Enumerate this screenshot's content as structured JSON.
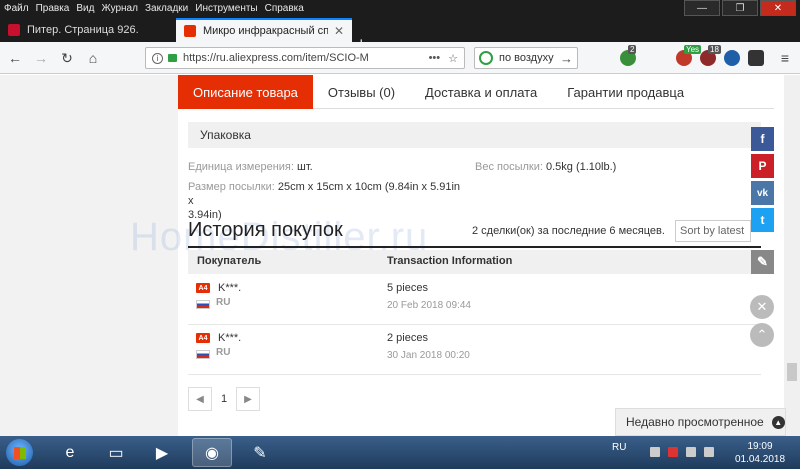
{
  "menubar": {
    "items": [
      "Файл",
      "Правка",
      "Вид",
      "Журнал",
      "Закладки",
      "Инструменты",
      "Справка"
    ]
  },
  "tabs": [
    {
      "title": "Питер. Страница 926.",
      "color": "#c8102e"
    },
    {
      "title": "Микро инфракрасный спектр",
      "color": "#e62e04"
    }
  ],
  "navbar": {
    "url": "https://ru.aliexpress.com/item/SCIO-M",
    "search_text": "по воздуху",
    "ext_badges": [
      "2",
      "Yes",
      "18"
    ]
  },
  "product_tabs": [
    "Описание товара",
    "Отзывы (0)",
    "Доставка и оплата",
    "Гарантии продавца"
  ],
  "packaging": {
    "header": "Упаковка",
    "unit_label": "Единица измерения:",
    "unit_value": "шт.",
    "weight_label": "Вес посылки:",
    "weight_value": "0.5kg (1.10lb.)",
    "size_label": "Размер посылки:",
    "size_value_1": "25cm x 15cm x 10cm (9.84in x 5.91in x",
    "size_value_2": "3.94in)"
  },
  "history": {
    "title": "История покупок",
    "count": "2 сделки(ок) за последние 6 месяцев.",
    "sort": "Sort by latest",
    "col_buyer": "Покупатель",
    "col_info": "Transaction Information",
    "rows": [
      {
        "level": "A4",
        "buyer": "K***.",
        "country": "RU",
        "qty": "5 pieces",
        "date": "20 Feb 2018 09:44"
      },
      {
        "level": "A4",
        "buyer": "K***.",
        "country": "RU",
        "qty": "2 pieces",
        "date": "30 Jan 2018 00:20"
      }
    ],
    "page": "1"
  },
  "social": [
    "f",
    "P",
    "vk",
    "t"
  ],
  "recently_viewed": "Недавно просмотренное",
  "watermark": "HomeDistiller.ru",
  "taskbar": {
    "lang": "RU",
    "time": "19:09",
    "date": "01.04.2018"
  }
}
